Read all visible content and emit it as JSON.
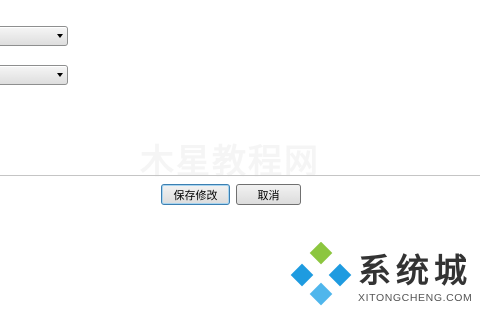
{
  "form": {
    "select_1_value": "",
    "select_2_value": ""
  },
  "watermark": {
    "text": "木星教程网"
  },
  "actions": {
    "save_label": "保存修改",
    "cancel_label": "取消"
  },
  "logo": {
    "cn_text": "系统城",
    "en_text": "XITONGCHENG.COM",
    "colors": {
      "green": "#8cc63f",
      "blue": "#1e9be0",
      "light_blue": "#4fb6ec"
    }
  }
}
